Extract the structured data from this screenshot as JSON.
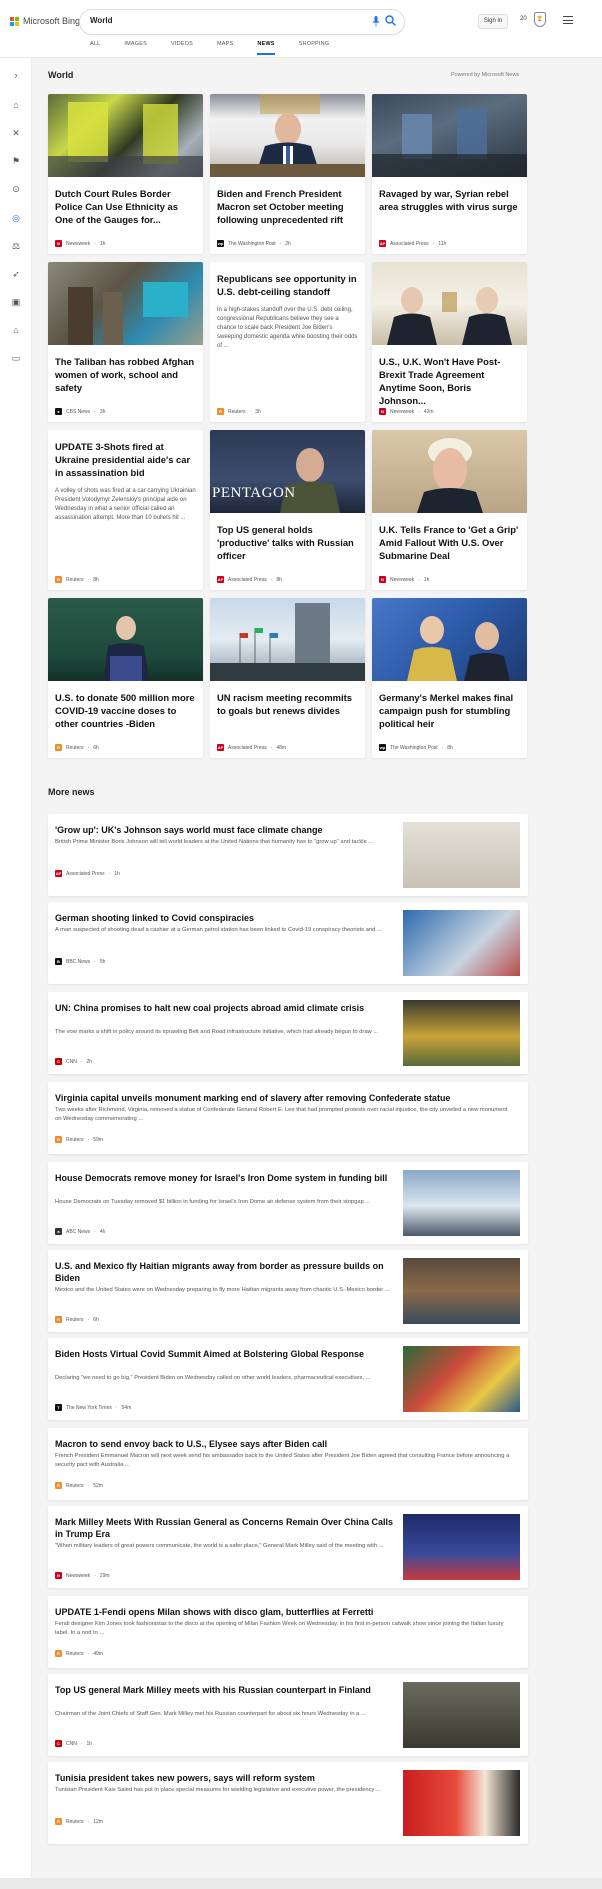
{
  "brand": {
    "name": "Microsoft Bing",
    "colors": [
      "#f25022",
      "#7fba00",
      "#00a4ef",
      "#ffb900"
    ]
  },
  "search": {
    "query": "World",
    "mic_icon": "microphone-icon",
    "search_icon": "search-icon"
  },
  "header": {
    "sign_in": "Sign in",
    "rewards_count": "20"
  },
  "tabs": [
    {
      "label": "ALL"
    },
    {
      "label": "IMAGES"
    },
    {
      "label": "VIDEOS"
    },
    {
      "label": "MAPS"
    },
    {
      "label": "NEWS",
      "active": true
    },
    {
      "label": "SHOPPING"
    }
  ],
  "sidebar": {
    "icons": [
      "chevron-right-icon",
      "home-icon",
      "tools-icon",
      "flag-icon",
      "location-pin-icon",
      "globe-icon",
      "scale-icon",
      "rocket-icon",
      "video-icon",
      "bank-icon",
      "card-icon"
    ]
  },
  "section_world": {
    "title": "World",
    "powered_by": "Powered by Microsoft News"
  },
  "cards": [
    {
      "title": "Dutch Court Rules Border Police Can Use Ethnicity as One of the Gauges for...",
      "source": "Newsweek",
      "time": "1h",
      "badge": "N",
      "badge_color": "#d0021b"
    },
    {
      "title": "Biden and French President Macron set October meeting following unprecedented rift",
      "source": "The Washington Post",
      "time": "2h",
      "badge": "wp",
      "badge_color": "#111111"
    },
    {
      "title": "Ravaged by war, Syrian rebel area struggles with virus surge",
      "source": "Associated Press",
      "time": "11h",
      "badge": "AP",
      "badge_color": "#d0021b"
    },
    {
      "title": "The Taliban has robbed Afghan women of work, school and safety",
      "source": "CBS News",
      "time": "3h",
      "badge": "●",
      "badge_color": "#111111"
    },
    {
      "title": "Republicans see opportunity in U.S. debt-ceiling standoff",
      "snippet": "In a high-stakes standoff over the U.S. debt ceiling, congressional Republicans believe they see a chance to scale back President Joe Biden's sweeping domestic agenda while boosting their odds of ...",
      "source": "Reuters",
      "time": "3h",
      "badge": "R",
      "badge_color": "#f28c28"
    },
    {
      "title": "U.S., U.K. Won't Have Post-Brexit Trade Agreement Anytime Soon, Boris Johnson...",
      "source": "Newsweek",
      "time": "42m",
      "badge": "N",
      "badge_color": "#d0021b"
    },
    {
      "title": "UPDATE 3-Shots fired at Ukraine presidential aide's car in assassination bid",
      "snippet": "A volley of shots was fired at a car carrying Ukrainian President Volodymyr Zelenskiy's principal aide on Wednesday in what a senior official called an assassination attempt. More than 10 bullets hit ...",
      "source": "Reuters",
      "time": "8h",
      "badge": "R",
      "badge_color": "#f28c28"
    },
    {
      "title": "Top US general holds 'productive' talks with Russian officer",
      "source": "Associated Press",
      "time": "8h",
      "badge": "AP",
      "badge_color": "#d0021b",
      "image_text": "PENTAGON"
    },
    {
      "title": "U.K. Tells France to 'Get a Grip' Amid Fallout With U.S. Over Submarine Deal",
      "source": "Newsweek",
      "time": "1h",
      "badge": "N",
      "badge_color": "#d0021b"
    },
    {
      "title": "U.S. to donate 500 million more COVID-19 vaccine doses to other countries -Biden",
      "source": "Reuters",
      "time": "6h",
      "badge": "R",
      "badge_color": "#f28c28"
    },
    {
      "title": "UN racism meeting recommits to goals but renews divides",
      "source": "Associated Press",
      "time": "48m",
      "badge": "AP",
      "badge_color": "#d0021b"
    },
    {
      "title": "Germany's Merkel makes final campaign push for stumbling political heir",
      "source": "The Washington Post",
      "time": "8h",
      "badge": "wp",
      "badge_color": "#111111"
    }
  ],
  "section_more": {
    "title": "More news"
  },
  "more_news": [
    {
      "title": "'Grow up': UK's Johnson says world must face climate change",
      "desc": "British Prime Minister Boris Johnson will tell world leaders at the United Nations that humanity has to \"grow up\" and tackle ...",
      "source": "Associated Press",
      "time": "1h",
      "badge": "AP",
      "badge_color": "#d0021b",
      "thumb": true
    },
    {
      "title": "German shooting linked to Covid conspiracies",
      "desc": "A man suspected of shooting dead a cashier at a German petrol station has been linked to Covid-19 conspiracy theorists and ...",
      "source": "BBC News",
      "time": "5h",
      "badge": "B",
      "badge_color": "#111111",
      "thumb": true
    },
    {
      "title": "UN: China promises to halt new coal projects abroad amid climate crisis",
      "desc": "The vow marks a shift in policy around its sprawling Belt and Road infrastructure initiative, which had already begun to draw ...",
      "source": "CNN",
      "time": "2h",
      "badge": "C",
      "badge_color": "#cc0000",
      "thumb": true
    },
    {
      "title": "Virginia capital unveils monument marking end of slavery after removing Confederate statue",
      "desc": "Two weeks after Richmond, Virginia, removed a statue of Confederate General Robert E. Lee that had prompted protests over racial injustice, the city unveiled a new monument on Wednesday commemorating ...",
      "source": "Reuters",
      "time": "59m",
      "badge": "R",
      "badge_color": "#f28c28",
      "thumb": false
    },
    {
      "title": "House Democrats remove money for Israel's Iron Dome system in funding bill",
      "desc": "House Democrats on Tuesday removed $1 billion in funding for Israel's Iron Dome air defense system from their stopgap ...",
      "source": "ABC News",
      "time": "4h",
      "badge": "a",
      "badge_color": "#333333",
      "thumb": true
    },
    {
      "title": "U.S. and Mexico fly Haitian migrants away from border as pressure builds on Biden",
      "desc": "Mexico and the United States were on Wednesday preparing to fly more Haitian migrants away from chaotic U.S.-Mexico border ...",
      "source": "Reuters",
      "time": "6h",
      "badge": "R",
      "badge_color": "#f28c28",
      "thumb": true
    },
    {
      "title": "Biden Hosts Virtual Covid Summit Aimed at Bolstering Global Response",
      "desc": "Declaring \"we need to go big,\" President Biden on Wednesday called on other world leaders, pharmaceutical executives, ...",
      "source": "The New York Times",
      "time": "54m",
      "badge": "T",
      "badge_color": "#111111",
      "thumb": true
    },
    {
      "title": "Macron to send envoy back to U.S., Elysee says after Biden call",
      "desc": "French President Emmanuel Macron will next week send his ambassador back to the United States after President Joe Biden agreed that consulting France before announcing a security pact with Australia ...",
      "source": "Reuters",
      "time": "52m",
      "badge": "R",
      "badge_color": "#f28c28",
      "thumb": false
    },
    {
      "title": "Mark Milley Meets With Russian General as Concerns Remain Over China Calls in Trump Era",
      "desc": "\"When military leaders of great powers communicate, the world is a safer place,\" General Mark Milley said of the meeting with ...",
      "source": "Newsweek",
      "time": "29m",
      "badge": "N",
      "badge_color": "#d0021b",
      "thumb": true
    },
    {
      "title": "UPDATE 1-Fendi opens Milan shows with disco glam, butterflies at Ferretti",
      "desc": "Fendi designer Kim Jones took fashionistas to the disco at the opening of Milan Fashion Week on Wednesday, in his first in-person catwalk show since joining the Italian luxury label. In a nod to ...",
      "source": "Reuters",
      "time": "49m",
      "badge": "R",
      "badge_color": "#f28c28",
      "thumb": false
    },
    {
      "title": "Top US general Mark Milley meets with his Russian counterpart in Finland",
      "desc": "Chairman of the Joint Chiefs of Staff Gen. Mark Milley met his Russian counterpart for about six hours Wednesday in a ...",
      "source": "CNN",
      "time": "1h",
      "badge": "C",
      "badge_color": "#cc0000",
      "thumb": true
    },
    {
      "title": "Tunisia president takes new powers, says will reform system",
      "desc": "Tunisian President Kais Saied has put in place special measures for wielding legislative and executive power, the presidency ...",
      "source": "Reuters",
      "time": "12m",
      "badge": "R",
      "badge_color": "#f28c28",
      "thumb": true
    }
  ]
}
